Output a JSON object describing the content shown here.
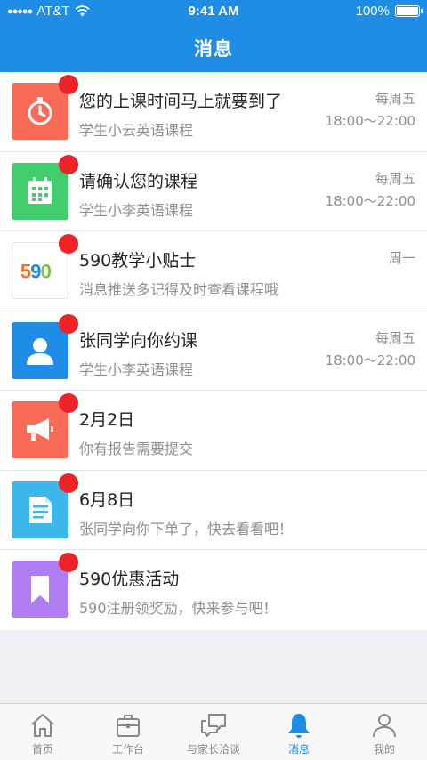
{
  "status_bar": {
    "carrier": "AT&T",
    "signal_dots": "●●●●●",
    "time": "9:41 AM",
    "battery": "100%"
  },
  "nav": {
    "title": "消息"
  },
  "messages": [
    {
      "icon": "stopwatch-icon",
      "icon_color": "#f96b56",
      "title": "您的上课时间马上就要到了",
      "subtitle": "学生小云英语课程",
      "day": "每周五",
      "time": "18:00～22:00"
    },
    {
      "icon": "calendar-icon",
      "icon_color": "#43cd6f",
      "title": "请确认您的课程",
      "subtitle": "学生小李英语课程",
      "day": "每周五",
      "time": "18:00～22:00"
    },
    {
      "icon": "logo-590-icon",
      "icon_color": "#ffffff",
      "logo_text": "590",
      "title": "590教学小贴士",
      "subtitle": "消息推送多记得及时查看课程哦",
      "day": "周一",
      "time": ""
    },
    {
      "icon": "person-icon",
      "icon_color": "#1f8ce6",
      "title": "张同学向你约课",
      "subtitle": "学生小李英语课程",
      "day": "每周五",
      "time": "18:00～22:00"
    },
    {
      "icon": "megaphone-icon",
      "icon_color": "#f96b56",
      "title": "2月2日",
      "subtitle": "你有报告需要提交",
      "day": "",
      "time": ""
    },
    {
      "icon": "document-icon",
      "icon_color": "#3cb7ea",
      "title": "6月8日",
      "subtitle": "张同学向你下单了，快去看看吧！",
      "day": "",
      "time": ""
    },
    {
      "icon": "bookmark-icon",
      "icon_color": "#b07ef0",
      "title": "590优惠活动",
      "subtitle": "590注册领奖励，快来参与吧！",
      "day": "",
      "time": ""
    }
  ],
  "tabs": [
    {
      "icon": "home-icon",
      "label": "首页",
      "active": false
    },
    {
      "icon": "briefcase-icon",
      "label": "工作台",
      "active": false
    },
    {
      "icon": "chat-icon",
      "label": "与家长洽谈",
      "active": false
    },
    {
      "icon": "bell-icon",
      "label": "消息",
      "active": true
    },
    {
      "icon": "user-icon",
      "label": "我的",
      "active": false
    }
  ],
  "colors": {
    "brand_blue": "#1f8ce6",
    "unread_red": "#ed2327"
  }
}
